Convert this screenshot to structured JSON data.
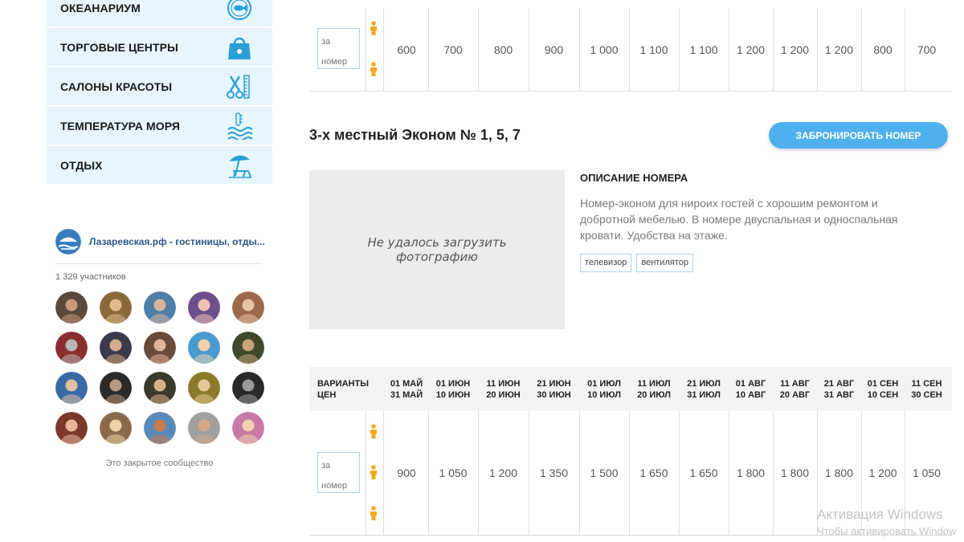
{
  "menu": {
    "items": [
      {
        "label": "ОКЕАНАРИУМ",
        "icon": "fish-icon"
      },
      {
        "label": "ТОРГОВЫЕ ЦЕНТРЫ",
        "icon": "shopping-bag-icon"
      },
      {
        "label": "САЛОНЫ КРАСОТЫ",
        "icon": "scissors-comb-icon"
      },
      {
        "label": "ТЕМПЕРАТУРА МОРЯ",
        "icon": "sea-thermometer-icon"
      },
      {
        "label": "ОТДЫХ",
        "icon": "beach-umbrella-icon"
      }
    ],
    "icon_color": "#2a9fd6",
    "bg_color": "#e6f6fc"
  },
  "vk": {
    "title": "Лазаревская.рф - гостиницы, отды...",
    "members": "1 329 участников",
    "closed_text": "Это закрытое сообщество",
    "avatar_count": 20
  },
  "table_top": {
    "unit": {
      "line1": "за",
      "line2": "номер"
    },
    "prices": [
      "600",
      "700",
      "800",
      "900",
      "1 000",
      "1 100",
      "1 100",
      "1 200",
      "1 200",
      "1 200",
      "800",
      "700"
    ]
  },
  "room": {
    "title": "3-х местный Эконом № 1, 5, 7",
    "book_button": "ЗАБРОНИРОВАТЬ НОМЕР",
    "photo_error": "Не удалось загрузить фотографию",
    "desc_heading": "ОПИСАНИЕ НОМЕРА",
    "desc_text": "Номер-эконом для нироих гостей с хорошим ремонтом и добротной мебелью. В номере двуспальная и односпальная кровати. Удобства на этаже.",
    "tags": [
      "телевизор",
      "вентилятор"
    ]
  },
  "table_bottom": {
    "header_first": {
      "line1": "ВАРИАНТЫ",
      "line2": "ЦЕН"
    },
    "columns": [
      {
        "line1": "01 МАЙ",
        "line2": "31 МАЙ"
      },
      {
        "line1": "01 ИЮН",
        "line2": "10 ИЮН"
      },
      {
        "line1": "11 ИЮН",
        "line2": "20 ИЮН"
      },
      {
        "line1": "21 ИЮН",
        "line2": "30 ИЮН"
      },
      {
        "line1": "01 ИЮЛ",
        "line2": "10 ИЮЛ"
      },
      {
        "line1": "11 ИЮЛ",
        "line2": "20 ИЮЛ"
      },
      {
        "line1": "21 ИЮЛ",
        "line2": "31 ИЮЛ"
      },
      {
        "line1": "01 АВГ",
        "line2": "10 АВГ"
      },
      {
        "line1": "11 АВГ",
        "line2": "20 АВГ"
      },
      {
        "line1": "21 АВГ",
        "line2": "31 АВГ"
      },
      {
        "line1": "01 СЕН",
        "line2": "10 СЕН"
      },
      {
        "line1": "11 СЕН",
        "line2": "30 СЕН"
      }
    ],
    "unit": {
      "line1": "за",
      "line2": "номер"
    },
    "prices": [
      "900",
      "1 050",
      "1 200",
      "1 350",
      "1 500",
      "1 650",
      "1 650",
      "1 800",
      "1 800",
      "1 800",
      "1 200",
      "1 050"
    ]
  },
  "watermark": {
    "line1": "Активация Windows",
    "line2": "Чтобы активировать Window"
  },
  "person_icon_color": "#f4a81d"
}
